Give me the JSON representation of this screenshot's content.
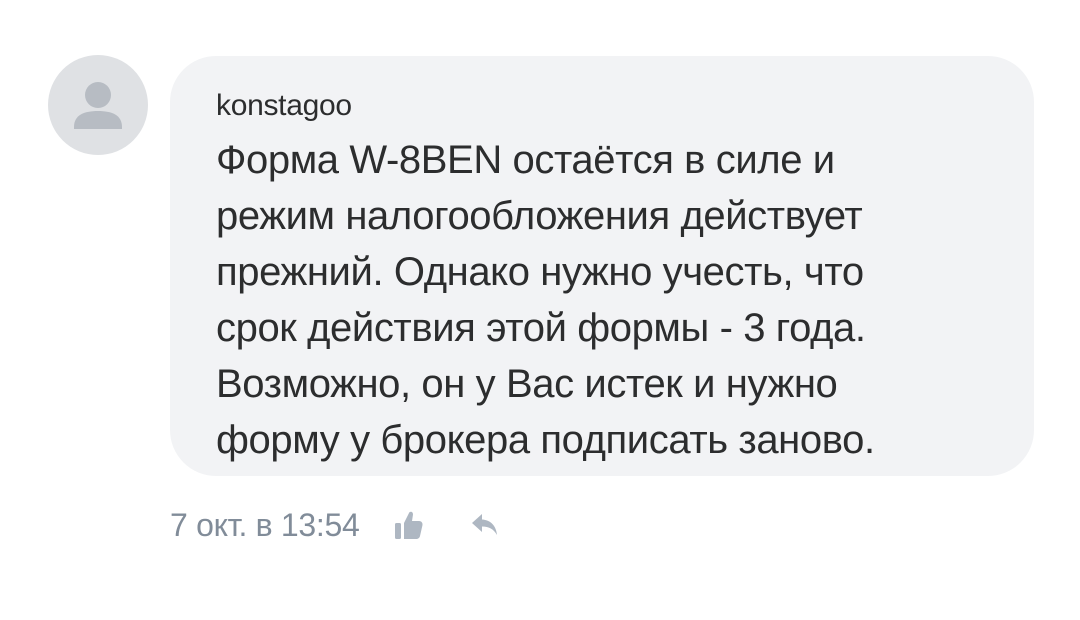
{
  "comment": {
    "author": "konstagoo",
    "message_lines": [
      "Форма W-8BEN остаётся в силе и",
      "режим налогообложения действует",
      "прежний. Однако нужно учесть, что",
      "срок действия этой формы - 3 года.",
      "Возможно, он у Вас истек и нужно",
      "форму у брокера подписать заново."
    ],
    "timestamp": "7 окт. в 13:54",
    "avatar_icon": "user-placeholder-icon",
    "like_icon": "thumbs-up-icon",
    "reply_icon": "reply-arrow-icon"
  },
  "colors": {
    "bubble_bg": "#f2f3f5",
    "text": "#2c2d2e",
    "meta": "#818c99",
    "avatar_bg": "#dfe1e4",
    "avatar_fg": "#b7bcc3",
    "icon": "#aeb7c2"
  }
}
